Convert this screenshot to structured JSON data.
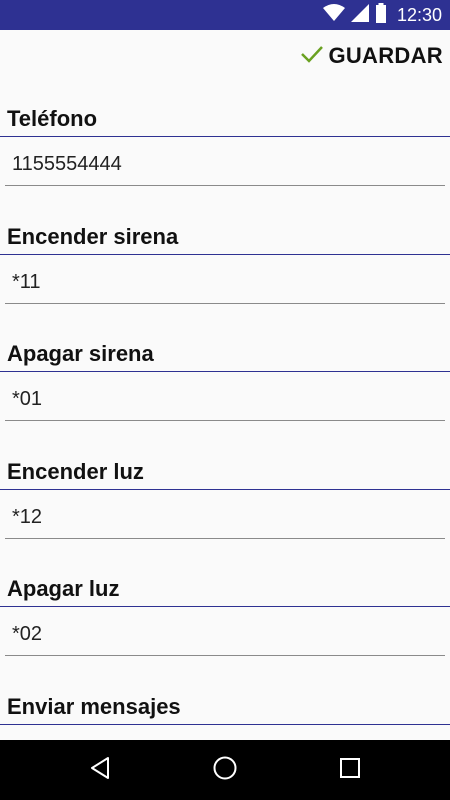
{
  "status_bar": {
    "time": "12:30",
    "icons": [
      "wifi-icon",
      "signal-icon",
      "battery-icon"
    ],
    "background": "#2e3192"
  },
  "toolbar": {
    "save_label": "GUARDAR",
    "save_icon": "check-icon",
    "check_color": "#6aa121"
  },
  "settings": [
    {
      "label": "Teléfono",
      "value": "1155554444"
    },
    {
      "label": "Encender sirena",
      "value": "*11"
    },
    {
      "label": "Apagar sirena",
      "value": "*01"
    },
    {
      "label": "Encender luz",
      "value": "*12"
    },
    {
      "label": "Apagar luz",
      "value": "*02"
    },
    {
      "label": "Enviar mensajes",
      "value": ""
    }
  ],
  "nav_bar": {
    "buttons": [
      "back-icon",
      "home-icon",
      "recents-icon"
    ]
  },
  "colors": {
    "accent": "#2e3192",
    "background": "#fafafa",
    "underline": "#8a8a8a"
  }
}
